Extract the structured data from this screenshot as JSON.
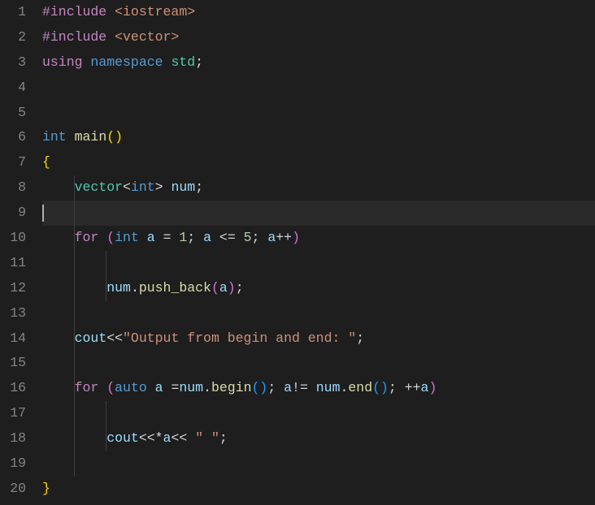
{
  "editor": {
    "current_line": 9,
    "lines": [
      {
        "num": "1",
        "tokens": [
          [
            "preproc",
            "#include"
          ],
          [
            "punct",
            " "
          ],
          [
            "header",
            "<iostream>"
          ]
        ]
      },
      {
        "num": "2",
        "tokens": [
          [
            "preproc",
            "#include"
          ],
          [
            "punct",
            " "
          ],
          [
            "header",
            "<vector>"
          ]
        ]
      },
      {
        "num": "3",
        "tokens": [
          [
            "using",
            "using"
          ],
          [
            "punct",
            " "
          ],
          [
            "ns",
            "namespace"
          ],
          [
            "punct",
            " "
          ],
          [
            "class",
            "std"
          ],
          [
            "punct",
            ";"
          ]
        ]
      },
      {
        "num": "4",
        "tokens": []
      },
      {
        "num": "5",
        "tokens": []
      },
      {
        "num": "6",
        "tokens": [
          [
            "type",
            "int"
          ],
          [
            "punct",
            " "
          ],
          [
            "func",
            "main"
          ],
          [
            "brace",
            "("
          ],
          [
            "brace",
            ")"
          ]
        ]
      },
      {
        "num": "7",
        "tokens": [
          [
            "brace",
            "{"
          ]
        ]
      },
      {
        "num": "8",
        "tokens": [
          [
            "punct",
            "    "
          ],
          [
            "class",
            "vector"
          ],
          [
            "punct",
            "<"
          ],
          [
            "type",
            "int"
          ],
          [
            "punct",
            "> "
          ],
          [
            "ident",
            "num"
          ],
          [
            "punct",
            ";"
          ]
        ]
      },
      {
        "num": "9",
        "tokens": [],
        "cursor": true
      },
      {
        "num": "10",
        "tokens": [
          [
            "punct",
            "    "
          ],
          [
            "using",
            "for"
          ],
          [
            "punct",
            " "
          ],
          [
            "brace1",
            "("
          ],
          [
            "type",
            "int"
          ],
          [
            "punct",
            " "
          ],
          [
            "ident",
            "a"
          ],
          [
            "punct",
            " = "
          ],
          [
            "number",
            "1"
          ],
          [
            "punct",
            "; "
          ],
          [
            "ident",
            "a"
          ],
          [
            "punct",
            " <= "
          ],
          [
            "number",
            "5"
          ],
          [
            "punct",
            "; "
          ],
          [
            "ident",
            "a"
          ],
          [
            "punct",
            "++"
          ],
          [
            "brace1",
            ")"
          ]
        ]
      },
      {
        "num": "11",
        "tokens": []
      },
      {
        "num": "12",
        "tokens": [
          [
            "punct",
            "        "
          ],
          [
            "ident",
            "num"
          ],
          [
            "punct",
            "."
          ],
          [
            "func",
            "push_back"
          ],
          [
            "brace1",
            "("
          ],
          [
            "ident",
            "a"
          ],
          [
            "brace1",
            ")"
          ],
          [
            "punct",
            ";"
          ]
        ]
      },
      {
        "num": "13",
        "tokens": []
      },
      {
        "num": "14",
        "tokens": [
          [
            "punct",
            "    "
          ],
          [
            "ident",
            "cout"
          ],
          [
            "punct",
            "<<"
          ],
          [
            "string",
            "\"Output from begin and end: \""
          ],
          [
            "punct",
            ";"
          ]
        ]
      },
      {
        "num": "15",
        "tokens": []
      },
      {
        "num": "16",
        "tokens": [
          [
            "punct",
            "    "
          ],
          [
            "using",
            "for"
          ],
          [
            "punct",
            " "
          ],
          [
            "brace1",
            "("
          ],
          [
            "type",
            "auto"
          ],
          [
            "punct",
            " "
          ],
          [
            "ident",
            "a"
          ],
          [
            "punct",
            " ="
          ],
          [
            "ident",
            "num"
          ],
          [
            "punct",
            "."
          ],
          [
            "func",
            "begin"
          ],
          [
            "brace2",
            "("
          ],
          [
            "brace2",
            ")"
          ],
          [
            "punct",
            "; "
          ],
          [
            "ident",
            "a"
          ],
          [
            "punct",
            "!= "
          ],
          [
            "ident",
            "num"
          ],
          [
            "punct",
            "."
          ],
          [
            "func",
            "end"
          ],
          [
            "brace2",
            "("
          ],
          [
            "brace2",
            ")"
          ],
          [
            "punct",
            "; ++"
          ],
          [
            "ident",
            "a"
          ],
          [
            "brace1",
            ")"
          ]
        ]
      },
      {
        "num": "17",
        "tokens": []
      },
      {
        "num": "18",
        "tokens": [
          [
            "punct",
            "        "
          ],
          [
            "ident",
            "cout"
          ],
          [
            "punct",
            "<<*"
          ],
          [
            "ident",
            "a"
          ],
          [
            "punct",
            "<< "
          ],
          [
            "string",
            "\" \""
          ],
          [
            "punct",
            ";"
          ]
        ]
      },
      {
        "num": "19",
        "tokens": []
      },
      {
        "num": "20",
        "tokens": [
          [
            "brace",
            "}"
          ]
        ]
      }
    ],
    "indent_guides": {
      "8": [
        1
      ],
      "9": [
        1
      ],
      "10": [
        1
      ],
      "11": [
        1,
        2
      ],
      "12": [
        1,
        2
      ],
      "13": [
        1
      ],
      "14": [
        1
      ],
      "15": [
        1
      ],
      "16": [
        1
      ],
      "17": [
        1,
        2
      ],
      "18": [
        1,
        2
      ],
      "19": [
        1
      ]
    }
  }
}
